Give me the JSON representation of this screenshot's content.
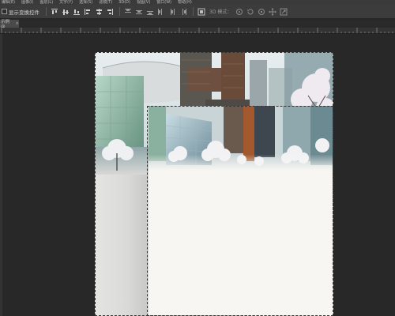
{
  "menubar": {
    "items": [
      "编辑(E)",
      "图像(I)",
      "图层(L)",
      "文字(Y)",
      "选择(S)",
      "滤镜(T)",
      "3D(D)",
      "视图(V)",
      "窗口(W)",
      "帮助(H)"
    ]
  },
  "options": {
    "transform_checkbox_label": "显示变换控件",
    "mode3d_label": "3D 模式："
  },
  "document": {
    "tab_title": "示例@",
    "close_glyph": "×"
  },
  "colors": {
    "workspace": "#282828",
    "panel": "#3c3c3c",
    "marquee": "#f0f0f0",
    "canvas_blank": "#f8f6f3"
  },
  "icons": {
    "align_group": [
      "align-top-icon",
      "align-vcenter-icon",
      "align-bottom-icon",
      "align-left-icon",
      "align-hcenter-icon",
      "align-right-icon"
    ],
    "distribute_group": [
      "distribute-top-icon",
      "distribute-vcenter-icon",
      "distribute-bottom-icon",
      "distribute-left-icon",
      "distribute-hcenter-icon",
      "distribute-right-icon"
    ],
    "auto_align": "auto-align-icon",
    "mode3d_group": [
      "rotate-3d-icon",
      "roll-3d-icon",
      "drag-3d-icon",
      "slide-3d-icon",
      "scale-3d-icon"
    ]
  }
}
